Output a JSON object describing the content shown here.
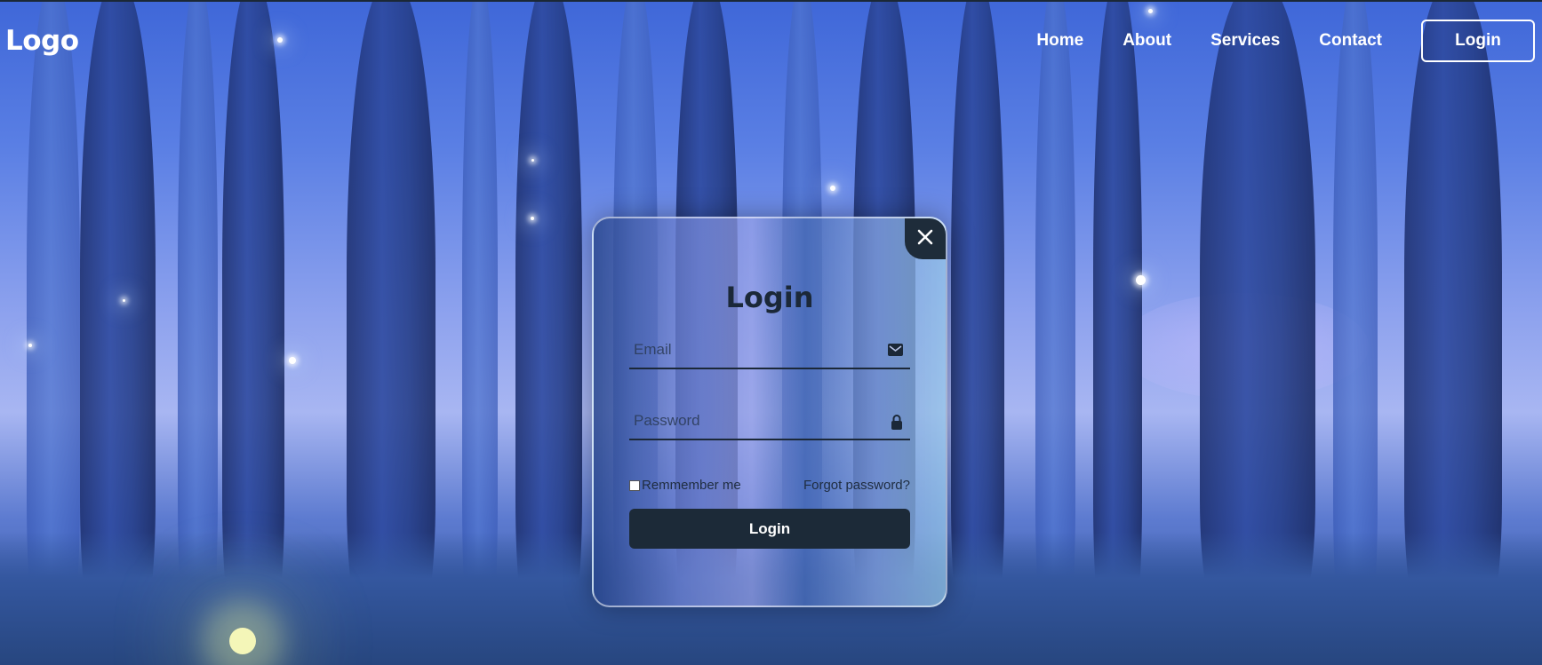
{
  "header": {
    "logo": "Logo",
    "nav": [
      "Home",
      "About",
      "Services",
      "Contact"
    ],
    "login_button": "Login"
  },
  "modal": {
    "title": "Login",
    "email_placeholder": "Email",
    "password_placeholder": "Password",
    "remember_label": "Remmember me",
    "forgot_label": "Forgot password?",
    "submit_label": "Login"
  },
  "icons": {
    "close": "close-icon",
    "email": "mail-icon",
    "password": "lock-icon"
  },
  "colors": {
    "accent_dark": "#1c2a38",
    "text_light": "#ffffff"
  }
}
